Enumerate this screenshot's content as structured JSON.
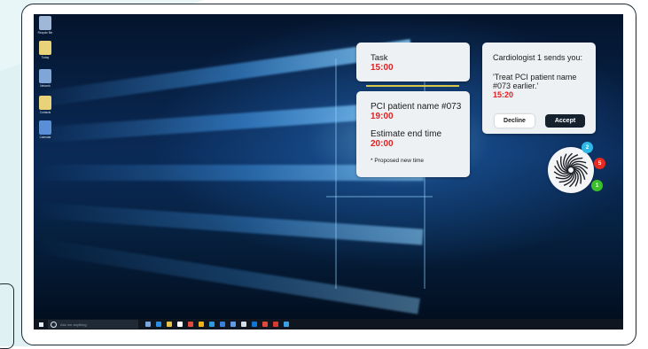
{
  "desktop": {
    "icons": [
      {
        "label": "Recycle Bin",
        "color": "#9fb8d8"
      },
      {
        "label": "Today",
        "color": "#e8d27a"
      },
      {
        "label": "Network",
        "color": "#7fa6d6"
      },
      {
        "label": "Contacts",
        "color": "#e8d27a"
      },
      {
        "label": "Calendar",
        "color": "#5a8fd8"
      }
    ]
  },
  "task_card": {
    "label": "Task",
    "time": "15:00"
  },
  "pci_card": {
    "patient_label": "PCI patient name #073",
    "patient_time": "19:00",
    "estimate_label": "Estimate end time",
    "estimate_time": "20:00",
    "note": "* Proposed new time"
  },
  "message_card": {
    "from": "Cardiologist 1 sends you:",
    "quote": "'Treat PCI patient name #073 earlier.'",
    "time": "15:20",
    "decline_label": "Decline",
    "accept_label": "Accept"
  },
  "assistant": {
    "icon": "philips-shield-swirl-icon",
    "badges": {
      "blue": "2",
      "red": "5",
      "green": "1"
    }
  },
  "taskbar": {
    "search_placeholder": "Ask me anything",
    "apps": [
      "#7aa7e0",
      "#2b8de0",
      "#e8c34a",
      "#ffffff",
      "#e24b3b",
      "#f2b21b",
      "#2f9bdc",
      "#3c7fd8",
      "#5e9ce6",
      "#d6dfe8",
      "#0f76d6",
      "#e0483b",
      "#d93a2f",
      "#3aa0e8"
    ]
  },
  "colors": {
    "accent_red": "#e02020",
    "accept_bg": "#16212e",
    "badge_blue": "#2fb8e6",
    "badge_red": "#e52a1f",
    "badge_green": "#3bbf2a"
  }
}
